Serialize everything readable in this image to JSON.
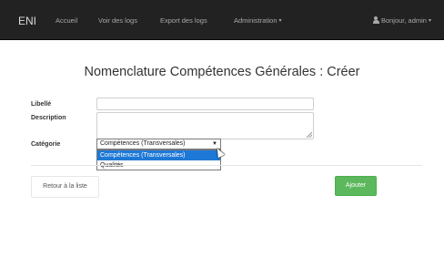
{
  "navbar": {
    "brand": "ENI",
    "links": [
      "Accueil",
      "Voir des logs",
      "Export des logs",
      "Administration"
    ],
    "user": "Bonjour, admin"
  },
  "page": {
    "title": "Nomenclature Compétences Générales : Créer"
  },
  "form": {
    "libelle_label": "Libellé",
    "libelle_value": "",
    "description_label": "Description",
    "description_value": "",
    "categorie_label": "Catégorie",
    "categorie_selected": "Compétences (Transversales)",
    "categorie_options": [
      "Compétences (Transversales)",
      "Qualités"
    ],
    "categorie_highlighted_index": 0
  },
  "actions": {
    "back_label": "Retour à la liste",
    "submit_label": "Ajouter"
  },
  "colors": {
    "navbar_bg": "#222222",
    "submit_bg": "#5cb85c",
    "option_highlight": "#1e78d6"
  },
  "icons": [
    "user-icon",
    "caret-down-icon",
    "resize-grip-icon",
    "mouse-cursor-icon"
  ]
}
